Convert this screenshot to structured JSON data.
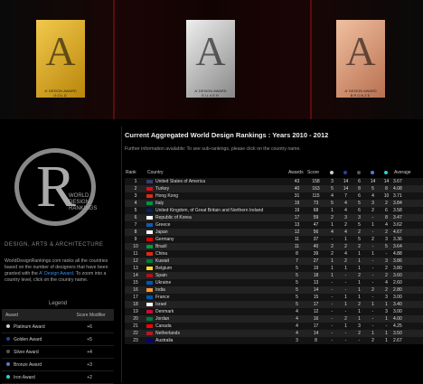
{
  "awards": [
    {
      "label": "A' DESIGN AWARD",
      "sub": "GOLD"
    },
    {
      "label": "A' DESIGN AWARD",
      "sub": "SILVER"
    },
    {
      "label": "A' DESIGN AWARD",
      "sub": "BRONZE"
    }
  ],
  "logo": {
    "letter": "R",
    "line1": "WORLD",
    "line2": "DESIGN",
    "line3": "RANKINGS"
  },
  "tagline": "DESIGN, ARTS & ARCHITECTURE",
  "description": {
    "text": "WorldDesignRankings.com ranks all the countries based on the number of designers that have been granted with the ",
    "link": "A' Design Award",
    "text2": ". To zoom into a country level, click on the country name."
  },
  "legend": {
    "title": "Legend",
    "col_award": "Award",
    "col_modifier": "Score Modifier",
    "rows": [
      {
        "name": "Platinum Award",
        "modifier": "+6",
        "color": "#cccccc"
      },
      {
        "name": "Golden Award",
        "modifier": "+5",
        "color": "#2b3fa0"
      },
      {
        "name": "Silver Award",
        "modifier": "+4",
        "color": "#555555"
      },
      {
        "name": "Bronze Award",
        "modifier": "+3",
        "color": "#4f7fd6"
      },
      {
        "name": "Iron Award",
        "modifier": "+2",
        "color": "#2fd0d0"
      }
    ]
  },
  "rankings": {
    "title": "Current Aggregated World Design Rankings : Years 2010 - 2012",
    "info": "Further information available: To see sub-rankings, please click on the country name.",
    "headers": {
      "rank": "Rank",
      "country": "Country",
      "awards": "Awards",
      "score": "Score",
      "average": "Average"
    },
    "header_dot_colors": [
      "#cccccc",
      "#2b3fa0",
      "#555555",
      "#4f7fd6",
      "#2fd0d0"
    ],
    "rows": [
      {
        "rank": "1",
        "country": "United States of America",
        "flag": "#3c3b6e",
        "awards": "43",
        "score": "158",
        "c1": "3",
        "c2": "14",
        "c3": "6",
        "c4": "14",
        "c5": "14",
        "avg": "3.67"
      },
      {
        "rank": "2",
        "country": "Turkey",
        "flag": "#e30a17",
        "awards": "40",
        "score": "163",
        "c1": "5",
        "c2": "14",
        "c3": "8",
        "c4": "5",
        "c5": "8",
        "avg": "4.08"
      },
      {
        "rank": "3",
        "country": "Hong Kong",
        "flag": "#de2910",
        "awards": "31",
        "score": "115",
        "c1": "4",
        "c2": "7",
        "c3": "6",
        "c4": "4",
        "c5": "10",
        "avg": "3.71"
      },
      {
        "rank": "4",
        "country": "Italy",
        "flag": "#009246",
        "awards": "19",
        "score": "73",
        "c1": "5",
        "c2": "4",
        "c3": "5",
        "c4": "3",
        "c5": "2",
        "avg": "3.84"
      },
      {
        "rank": "5",
        "country": "United Kingdom, of Great Britain and Northern Ireland",
        "flag": "#012169",
        "awards": "19",
        "score": "68",
        "c1": "1",
        "c2": "4",
        "c3": "6",
        "c4": "2",
        "c5": "6",
        "avg": "3.58"
      },
      {
        "rank": "6",
        "country": "Republic of Korea",
        "flag": "#ffffff",
        "awards": "17",
        "score": "59",
        "c1": "2",
        "c2": "3",
        "c3": "3",
        "c4": "-",
        "c5": "8",
        "avg": "3.47"
      },
      {
        "rank": "7",
        "country": "Greece",
        "flag": "#0d5eaf",
        "awards": "13",
        "score": "47",
        "c1": "1",
        "c2": "2",
        "c3": "5",
        "c4": "1",
        "c5": "4",
        "avg": "3.62"
      },
      {
        "rank": "8",
        "country": "Japan",
        "flag": "#ffffff",
        "awards": "12",
        "score": "56",
        "c1": "4",
        "c2": "4",
        "c3": "2",
        "c4": "-",
        "c5": "2",
        "avg": "4.67"
      },
      {
        "rank": "9",
        "country": "Germany",
        "flag": "#dd0000",
        "awards": "11",
        "score": "37",
        "c1": "-",
        "c2": "1",
        "c3": "5",
        "c4": "2",
        "c5": "3",
        "avg": "3.36"
      },
      {
        "rank": "10",
        "country": "Brazil",
        "flag": "#009c3b",
        "awards": "11",
        "score": "40",
        "c1": "2",
        "c2": "2",
        "c3": "2",
        "c4": "-",
        "c5": "5",
        "avg": "3.64"
      },
      {
        "rank": "11",
        "country": "China",
        "flag": "#de2910",
        "awards": "8",
        "score": "39",
        "c1": "2",
        "c2": "4",
        "c3": "1",
        "c4": "1",
        "c5": "-",
        "avg": "4.88"
      },
      {
        "rank": "12",
        "country": "Kuwait",
        "flag": "#007a3d",
        "awards": "7",
        "score": "27",
        "c1": "1",
        "c2": "2",
        "c3": "1",
        "c4": "-",
        "c5": "3",
        "avg": "3.86"
      },
      {
        "rank": "13",
        "country": "Belgium",
        "flag": "#fdda24",
        "awards": "5",
        "score": "19",
        "c1": "1",
        "c2": "1",
        "c3": "1",
        "c4": "-",
        "c5": "2",
        "avg": "3.80"
      },
      {
        "rank": "14",
        "country": "Spain",
        "flag": "#aa151b",
        "awards": "5",
        "score": "18",
        "c1": "1",
        "c2": "-",
        "c3": "2",
        "c4": "-",
        "c5": "2",
        "avg": "3.60"
      },
      {
        "rank": "15",
        "country": "Ukraine",
        "flag": "#0057b7",
        "awards": "5",
        "score": "13",
        "c1": "-",
        "c2": "-",
        "c3": "1",
        "c4": "-",
        "c5": "4",
        "avg": "2.60"
      },
      {
        "rank": "16",
        "country": "India",
        "flag": "#ff9933",
        "awards": "5",
        "score": "14",
        "c1": "-",
        "c2": "-",
        "c3": "1",
        "c4": "2",
        "c5": "2",
        "avg": "2.80"
      },
      {
        "rank": "17",
        "country": "France",
        "flag": "#0055a4",
        "awards": "5",
        "score": "15",
        "c1": "-",
        "c2": "1",
        "c3": "1",
        "c4": "-",
        "c5": "3",
        "avg": "3.00"
      },
      {
        "rank": "18",
        "country": "Israel",
        "flag": "#ffffff",
        "awards": "5",
        "score": "17",
        "c1": "-",
        "c2": "1",
        "c3": "2",
        "c4": "1",
        "c5": "1",
        "avg": "3.40"
      },
      {
        "rank": "19",
        "country": "Denmark",
        "flag": "#c60c30",
        "awards": "4",
        "score": "12",
        "c1": "-",
        "c2": "-",
        "c3": "1",
        "c4": "-",
        "c5": "3",
        "avg": "3.00"
      },
      {
        "rank": "20",
        "country": "Jordan",
        "flag": "#007a3d",
        "awards": "4",
        "score": "16",
        "c1": "-",
        "c2": "2",
        "c3": "1",
        "c4": "-",
        "c5": "1",
        "avg": "4.00"
      },
      {
        "rank": "21",
        "country": "Canada",
        "flag": "#ff0000",
        "awards": "4",
        "score": "17",
        "c1": "-",
        "c2": "1",
        "c3": "3",
        "c4": "-",
        "c5": "-",
        "avg": "4.25"
      },
      {
        "rank": "22",
        "country": "Netherlands",
        "flag": "#ae1c28",
        "awards": "4",
        "score": "14",
        "c1": "-",
        "c2": "-",
        "c3": "2",
        "c4": "1",
        "c5": "1",
        "avg": "3.50"
      },
      {
        "rank": "23",
        "country": "Australia",
        "flag": "#00008b",
        "awards": "3",
        "score": "8",
        "c1": "-",
        "c2": "-",
        "c3": "-",
        "c4": "2",
        "c5": "1",
        "avg": "2.67"
      }
    ]
  }
}
